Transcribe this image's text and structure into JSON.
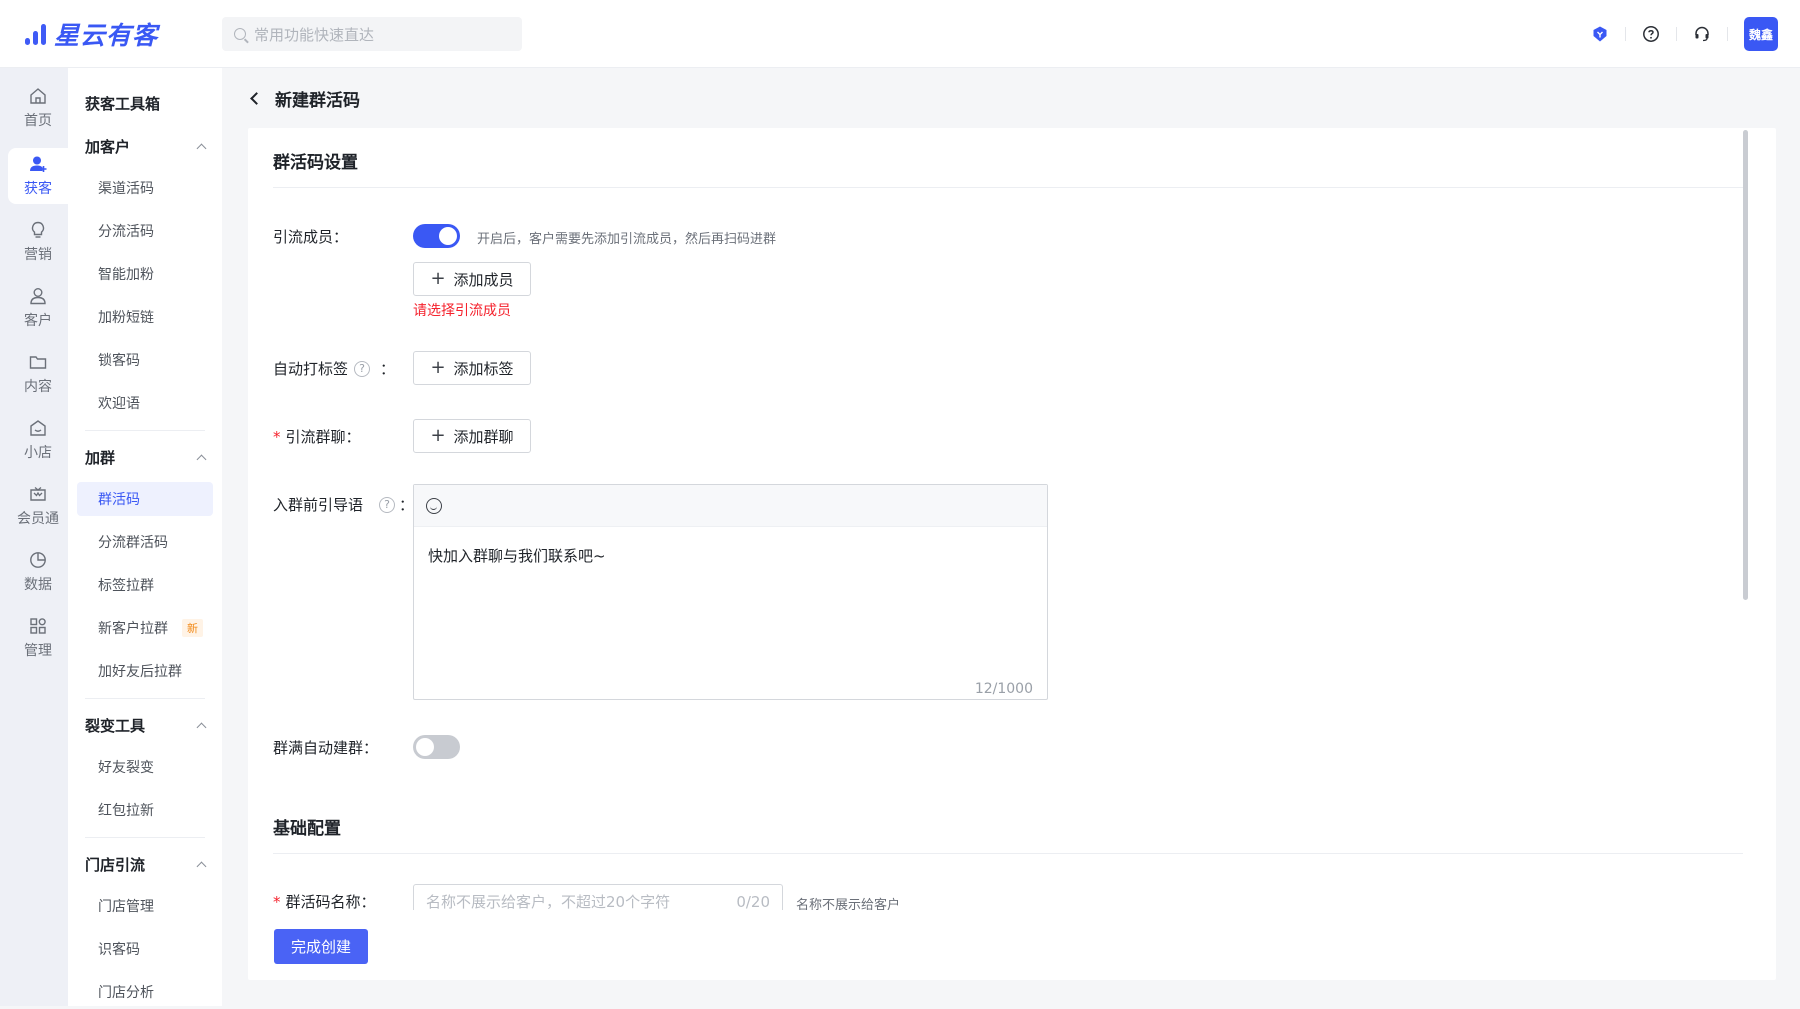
{
  "header": {
    "logo_text": "星云有客",
    "search_placeholder": "常用功能快速直达",
    "avatar_text": "魏鑫",
    "icons": [
      "shield-icon",
      "help-icon",
      "headset-icon"
    ],
    "accent": "#3a58f4"
  },
  "rail": [
    {
      "label": "首页",
      "icon": "home-icon"
    },
    {
      "label": "获客",
      "icon": "user-add-icon",
      "active": true
    },
    {
      "label": "营销",
      "icon": "bulb-icon"
    },
    {
      "label": "客户",
      "icon": "user-icon"
    },
    {
      "label": "内容",
      "icon": "folder-icon"
    },
    {
      "label": "小店",
      "icon": "shop-icon"
    },
    {
      "label": "会员通",
      "icon": "crown-icon"
    },
    {
      "label": "数据",
      "icon": "pie-icon"
    },
    {
      "label": "管理",
      "icon": "apps-icon"
    }
  ],
  "subnav": {
    "title": "获客工具箱",
    "groups": [
      {
        "title": "加客户",
        "items": [
          "渠道活码",
          "分流活码",
          "智能加粉",
          "加粉短链",
          "锁客码",
          "欢迎语"
        ]
      },
      {
        "title": "加群",
        "items": [
          "群活码",
          "分流群活码",
          "标签拉群",
          "新客户拉群",
          "加好友后拉群"
        ],
        "active": "群活码",
        "badge_item": "新客户拉群",
        "badge": "新"
      },
      {
        "title": "裂变工具",
        "items": [
          "好友裂变",
          "红包拉新"
        ]
      },
      {
        "title": "门店引流",
        "items": [
          "门店管理",
          "识客码",
          "门店分析"
        ]
      }
    ]
  },
  "page": {
    "title": "新建群活码",
    "section1_title": "群活码设置",
    "lead_member_label": "引流成员：",
    "lead_member_enabled": true,
    "lead_member_hint": "开启后，客户需要先添加引流成员，然后再扫码进群",
    "add_member_label": "添加成员",
    "member_error": "请选择引流成员",
    "auto_tag_label": "自动打标签",
    "add_tag_label": "添加标签",
    "lead_group_label": "引流群聊：",
    "add_group_label": "添加群聊",
    "guide_label": "入群前引导语",
    "guide_text": "快加入群聊与我们联系吧~",
    "guide_count": "12/1000",
    "auto_create_label": "群满自动建群：",
    "auto_create_enabled": false,
    "section2_title": "基础配置",
    "name_label": "群活码名称：",
    "name_placeholder": "名称不展示给客户，不超过20个字符",
    "name_count": "0/20",
    "name_hint": "名称不展示给客户",
    "submit_label": "完成创建",
    "colon": "："
  }
}
